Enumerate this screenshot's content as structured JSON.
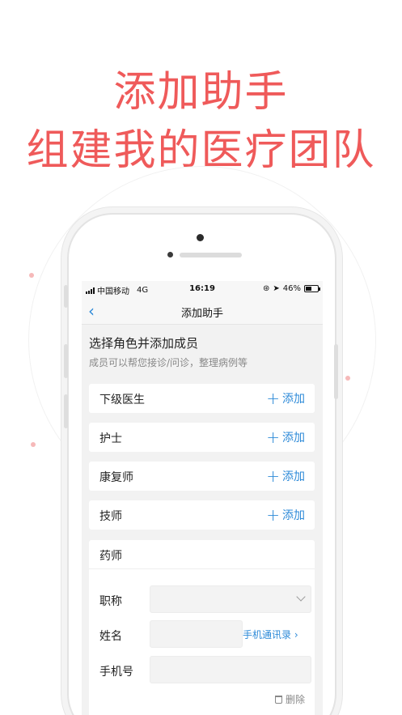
{
  "promo": {
    "line1": "添加助手",
    "line2": "组建我的医疗团队",
    "accent": "#ef5a5a"
  },
  "statusbar": {
    "carrier": "中国移动",
    "network": "4G",
    "time": "16:19",
    "battery": "46%"
  },
  "nav": {
    "back_icon": "chevron-left-icon",
    "title": "添加助手"
  },
  "intro": {
    "title": "选择角色并添加成员",
    "subtitle": "成员可以帮您接诊/问诊，整理病例等"
  },
  "roles": [
    {
      "label": "下级医生",
      "action": "添加"
    },
    {
      "label": "护士",
      "action": "添加"
    },
    {
      "label": "康复师",
      "action": "添加"
    },
    {
      "label": "技师",
      "action": "添加"
    }
  ],
  "expanded_role": {
    "label": "药师",
    "fields": {
      "title_label": "职称",
      "title_value": "",
      "name_label": "姓名",
      "name_value": "",
      "contacts_link": "手机通讯录 ›",
      "phone_label": "手机号",
      "phone_value": ""
    },
    "delete_label": "删除"
  },
  "colors": {
    "link": "#2d8ad8",
    "background": "#f2f2f2"
  }
}
